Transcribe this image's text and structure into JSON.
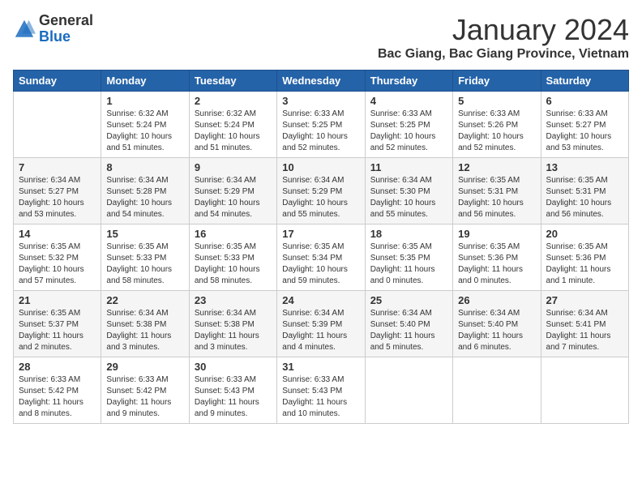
{
  "logo": {
    "general": "General",
    "blue": "Blue"
  },
  "title": {
    "month": "January 2024",
    "location": "Bac Giang, Bac Giang Province, Vietnam"
  },
  "headers": [
    "Sunday",
    "Monday",
    "Tuesday",
    "Wednesday",
    "Thursday",
    "Friday",
    "Saturday"
  ],
  "weeks": [
    [
      {
        "day": "",
        "info": ""
      },
      {
        "day": "1",
        "info": "Sunrise: 6:32 AM\nSunset: 5:24 PM\nDaylight: 10 hours\nand 51 minutes."
      },
      {
        "day": "2",
        "info": "Sunrise: 6:32 AM\nSunset: 5:24 PM\nDaylight: 10 hours\nand 51 minutes."
      },
      {
        "day": "3",
        "info": "Sunrise: 6:33 AM\nSunset: 5:25 PM\nDaylight: 10 hours\nand 52 minutes."
      },
      {
        "day": "4",
        "info": "Sunrise: 6:33 AM\nSunset: 5:25 PM\nDaylight: 10 hours\nand 52 minutes."
      },
      {
        "day": "5",
        "info": "Sunrise: 6:33 AM\nSunset: 5:26 PM\nDaylight: 10 hours\nand 52 minutes."
      },
      {
        "day": "6",
        "info": "Sunrise: 6:33 AM\nSunset: 5:27 PM\nDaylight: 10 hours\nand 53 minutes."
      }
    ],
    [
      {
        "day": "7",
        "info": "Sunrise: 6:34 AM\nSunset: 5:27 PM\nDaylight: 10 hours\nand 53 minutes."
      },
      {
        "day": "8",
        "info": "Sunrise: 6:34 AM\nSunset: 5:28 PM\nDaylight: 10 hours\nand 54 minutes."
      },
      {
        "day": "9",
        "info": "Sunrise: 6:34 AM\nSunset: 5:29 PM\nDaylight: 10 hours\nand 54 minutes."
      },
      {
        "day": "10",
        "info": "Sunrise: 6:34 AM\nSunset: 5:29 PM\nDaylight: 10 hours\nand 55 minutes."
      },
      {
        "day": "11",
        "info": "Sunrise: 6:34 AM\nSunset: 5:30 PM\nDaylight: 10 hours\nand 55 minutes."
      },
      {
        "day": "12",
        "info": "Sunrise: 6:35 AM\nSunset: 5:31 PM\nDaylight: 10 hours\nand 56 minutes."
      },
      {
        "day": "13",
        "info": "Sunrise: 6:35 AM\nSunset: 5:31 PM\nDaylight: 10 hours\nand 56 minutes."
      }
    ],
    [
      {
        "day": "14",
        "info": "Sunrise: 6:35 AM\nSunset: 5:32 PM\nDaylight: 10 hours\nand 57 minutes."
      },
      {
        "day": "15",
        "info": "Sunrise: 6:35 AM\nSunset: 5:33 PM\nDaylight: 10 hours\nand 58 minutes."
      },
      {
        "day": "16",
        "info": "Sunrise: 6:35 AM\nSunset: 5:33 PM\nDaylight: 10 hours\nand 58 minutes."
      },
      {
        "day": "17",
        "info": "Sunrise: 6:35 AM\nSunset: 5:34 PM\nDaylight: 10 hours\nand 59 minutes."
      },
      {
        "day": "18",
        "info": "Sunrise: 6:35 AM\nSunset: 5:35 PM\nDaylight: 11 hours\nand 0 minutes."
      },
      {
        "day": "19",
        "info": "Sunrise: 6:35 AM\nSunset: 5:36 PM\nDaylight: 11 hours\nand 0 minutes."
      },
      {
        "day": "20",
        "info": "Sunrise: 6:35 AM\nSunset: 5:36 PM\nDaylight: 11 hours\nand 1 minute."
      }
    ],
    [
      {
        "day": "21",
        "info": "Sunrise: 6:35 AM\nSunset: 5:37 PM\nDaylight: 11 hours\nand 2 minutes."
      },
      {
        "day": "22",
        "info": "Sunrise: 6:34 AM\nSunset: 5:38 PM\nDaylight: 11 hours\nand 3 minutes."
      },
      {
        "day": "23",
        "info": "Sunrise: 6:34 AM\nSunset: 5:38 PM\nDaylight: 11 hours\nand 3 minutes."
      },
      {
        "day": "24",
        "info": "Sunrise: 6:34 AM\nSunset: 5:39 PM\nDaylight: 11 hours\nand 4 minutes."
      },
      {
        "day": "25",
        "info": "Sunrise: 6:34 AM\nSunset: 5:40 PM\nDaylight: 11 hours\nand 5 minutes."
      },
      {
        "day": "26",
        "info": "Sunrise: 6:34 AM\nSunset: 5:40 PM\nDaylight: 11 hours\nand 6 minutes."
      },
      {
        "day": "27",
        "info": "Sunrise: 6:34 AM\nSunset: 5:41 PM\nDaylight: 11 hours\nand 7 minutes."
      }
    ],
    [
      {
        "day": "28",
        "info": "Sunrise: 6:33 AM\nSunset: 5:42 PM\nDaylight: 11 hours\nand 8 minutes."
      },
      {
        "day": "29",
        "info": "Sunrise: 6:33 AM\nSunset: 5:42 PM\nDaylight: 11 hours\nand 9 minutes."
      },
      {
        "day": "30",
        "info": "Sunrise: 6:33 AM\nSunset: 5:43 PM\nDaylight: 11 hours\nand 9 minutes."
      },
      {
        "day": "31",
        "info": "Sunrise: 6:33 AM\nSunset: 5:43 PM\nDaylight: 11 hours\nand 10 minutes."
      },
      {
        "day": "",
        "info": ""
      },
      {
        "day": "",
        "info": ""
      },
      {
        "day": "",
        "info": ""
      }
    ]
  ]
}
